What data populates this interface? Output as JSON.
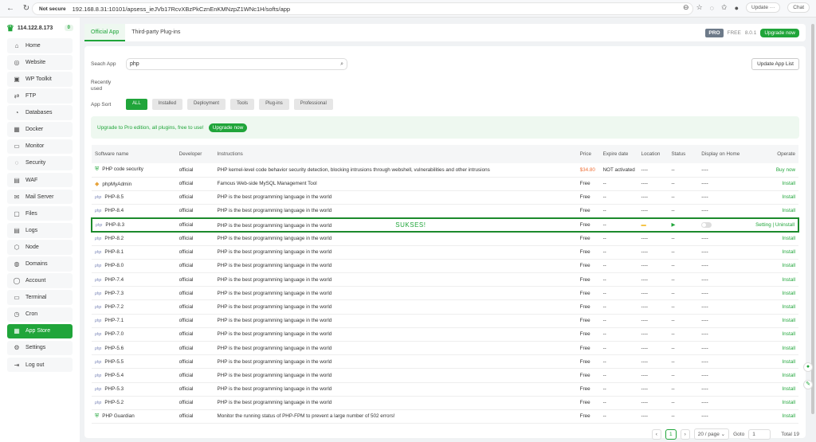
{
  "browser": {
    "not_secure": "Not secure",
    "url": "192.168.8.31:10101/apsess_ieJVb17RcvXBzPkCznEnKMNzpZ1WNc1H/softs/app",
    "update": "Update ···",
    "chat": "Chat"
  },
  "sidebar": {
    "server": "114.122.8.173",
    "badge": "0",
    "items": [
      {
        "label": "Home",
        "icon": "⌂"
      },
      {
        "label": "Website",
        "icon": "◎"
      },
      {
        "label": "WP Toolkit",
        "icon": "▣"
      },
      {
        "label": "FTP",
        "icon": "⇄"
      },
      {
        "label": "Databases",
        "icon": "◔"
      },
      {
        "label": "Docker",
        "icon": "▦"
      },
      {
        "label": "Monitor",
        "icon": "▭"
      },
      {
        "label": "Security",
        "icon": "◌"
      },
      {
        "label": "WAF",
        "icon": "▤"
      },
      {
        "label": "Mail Server",
        "icon": "✉"
      },
      {
        "label": "Files",
        "icon": "▢"
      },
      {
        "label": "Logs",
        "icon": "▤"
      },
      {
        "label": "Node",
        "icon": "⬡"
      },
      {
        "label": "Domains",
        "icon": "◍"
      },
      {
        "label": "Account",
        "icon": "◯"
      },
      {
        "label": "Terminal",
        "icon": "▭"
      },
      {
        "label": "Cron",
        "icon": "◷"
      },
      {
        "label": "App Store",
        "icon": "▦"
      },
      {
        "label": "Settings",
        "icon": "⚙"
      },
      {
        "label": "Log out",
        "icon": "⇥"
      }
    ]
  },
  "tabs": [
    {
      "label": "Official App"
    },
    {
      "label": "Third-party Plug-ins"
    }
  ],
  "header": {
    "pro": "PRO",
    "free": "FREE",
    "version": "8.0.1",
    "upgrade": "Upgrade now"
  },
  "search": {
    "label": "Seach App",
    "value": "php",
    "update_list": "Update App List"
  },
  "recent_label": "Recently used",
  "sort": {
    "label": "App Sort",
    "options": [
      "ALL",
      "Installed",
      "Deployment",
      "Tools",
      "Plug-ins",
      "Professional"
    ]
  },
  "promo": {
    "text": "Upgrade to Pro edition, all plugins, free to use!",
    "button": "Upgrade now"
  },
  "table": {
    "headers": [
      "Software name",
      "Developer",
      "Instructions",
      "Price",
      "Expire date",
      "Location",
      "Status",
      "Display on Home",
      "Operate"
    ],
    "rows": [
      {
        "name": "PHP code security",
        "dev": "official",
        "desc": "PHP kernel-level code behavior security detection, blocking intrusions through webshell, vulnerabilities and other intrusions",
        "price": "$34.80",
        "expire": "NOT activated",
        "loc": "----",
        "status": "--",
        "home": "----",
        "op": "Buy now"
      },
      {
        "name": "phpMyAdmin",
        "dev": "official",
        "desc": "Famous Web-side MySQL Management Tool",
        "price": "Free",
        "expire": "--",
        "loc": "----",
        "status": "--",
        "home": "----",
        "op": "Install"
      },
      {
        "name": "PHP-8.5",
        "dev": "official",
        "desc": "PHP is the best programming language in the world",
        "price": "Free",
        "expire": "--",
        "loc": "----",
        "status": "--",
        "home": "----",
        "op": "Install"
      },
      {
        "name": "PHP-8.4",
        "dev": "official",
        "desc": "PHP is the best programming language in the world",
        "price": "Free",
        "expire": "--",
        "loc": "----",
        "status": "--",
        "home": "----",
        "op": "Install"
      },
      {
        "name": "PHP-8.3",
        "dev": "official",
        "desc": "PHP is the best programming language in the world",
        "price": "Free",
        "expire": "--",
        "loc": "",
        "status": "",
        "home": "",
        "op": "Setting | Uninstall",
        "note": "SUKSES!",
        "installed": true
      },
      {
        "name": "PHP-8.2",
        "dev": "official",
        "desc": "PHP is the best programming language in the world",
        "price": "Free",
        "expire": "--",
        "loc": "----",
        "status": "--",
        "home": "----",
        "op": "Install"
      },
      {
        "name": "PHP-8.1",
        "dev": "official",
        "desc": "PHP is the best programming language in the world",
        "price": "Free",
        "expire": "--",
        "loc": "----",
        "status": "--",
        "home": "----",
        "op": "Install"
      },
      {
        "name": "PHP-8.0",
        "dev": "official",
        "desc": "PHP is the best programming language in the world",
        "price": "Free",
        "expire": "--",
        "loc": "----",
        "status": "--",
        "home": "----",
        "op": "Install"
      },
      {
        "name": "PHP-7.4",
        "dev": "official",
        "desc": "PHP is the best programming language in the world",
        "price": "Free",
        "expire": "--",
        "loc": "----",
        "status": "--",
        "home": "----",
        "op": "Install"
      },
      {
        "name": "PHP-7.3",
        "dev": "official",
        "desc": "PHP is the best programming language in the world",
        "price": "Free",
        "expire": "--",
        "loc": "----",
        "status": "--",
        "home": "----",
        "op": "Install"
      },
      {
        "name": "PHP-7.2",
        "dev": "official",
        "desc": "PHP is the best programming language in the world",
        "price": "Free",
        "expire": "--",
        "loc": "----",
        "status": "--",
        "home": "----",
        "op": "Install"
      },
      {
        "name": "PHP-7.1",
        "dev": "official",
        "desc": "PHP is the best programming language in the world",
        "price": "Free",
        "expire": "--",
        "loc": "----",
        "status": "--",
        "home": "----",
        "op": "Install"
      },
      {
        "name": "PHP-7.0",
        "dev": "official",
        "desc": "PHP is the best programming language in the world",
        "price": "Free",
        "expire": "--",
        "loc": "----",
        "status": "--",
        "home": "----",
        "op": "Install"
      },
      {
        "name": "PHP-5.6",
        "dev": "official",
        "desc": "PHP is the best programming language in the world",
        "price": "Free",
        "expire": "--",
        "loc": "----",
        "status": "--",
        "home": "----",
        "op": "Install"
      },
      {
        "name": "PHP-5.5",
        "dev": "official",
        "desc": "PHP is the best programming language in the world",
        "price": "Free",
        "expire": "--",
        "loc": "----",
        "status": "--",
        "home": "----",
        "op": "Install"
      },
      {
        "name": "PHP-5.4",
        "dev": "official",
        "desc": "PHP is the best programming language in the world",
        "price": "Free",
        "expire": "--",
        "loc": "----",
        "status": "--",
        "home": "----",
        "op": "Install"
      },
      {
        "name": "PHP-5.3",
        "dev": "official",
        "desc": "PHP is the best programming language in the world",
        "price": "Free",
        "expire": "--",
        "loc": "----",
        "status": "--",
        "home": "----",
        "op": "Install"
      },
      {
        "name": "PHP-5.2",
        "dev": "official",
        "desc": "PHP is the best programming language in the world",
        "price": "Free",
        "expire": "--",
        "loc": "----",
        "status": "--",
        "home": "----",
        "op": "Install"
      },
      {
        "name": "PHP Guardian",
        "dev": "official",
        "desc": "Monitor the running status of PHP-FPM to prevent a large number of 502 errors!",
        "price": "Free",
        "expire": "--",
        "loc": "----",
        "status": "--",
        "home": "----",
        "op": "Install"
      }
    ]
  },
  "pager": {
    "prev": "‹",
    "page": "1",
    "next": "›",
    "per_page": "20 / page",
    "goto": "Goto",
    "goto_value": "1",
    "total": "Total 19"
  }
}
